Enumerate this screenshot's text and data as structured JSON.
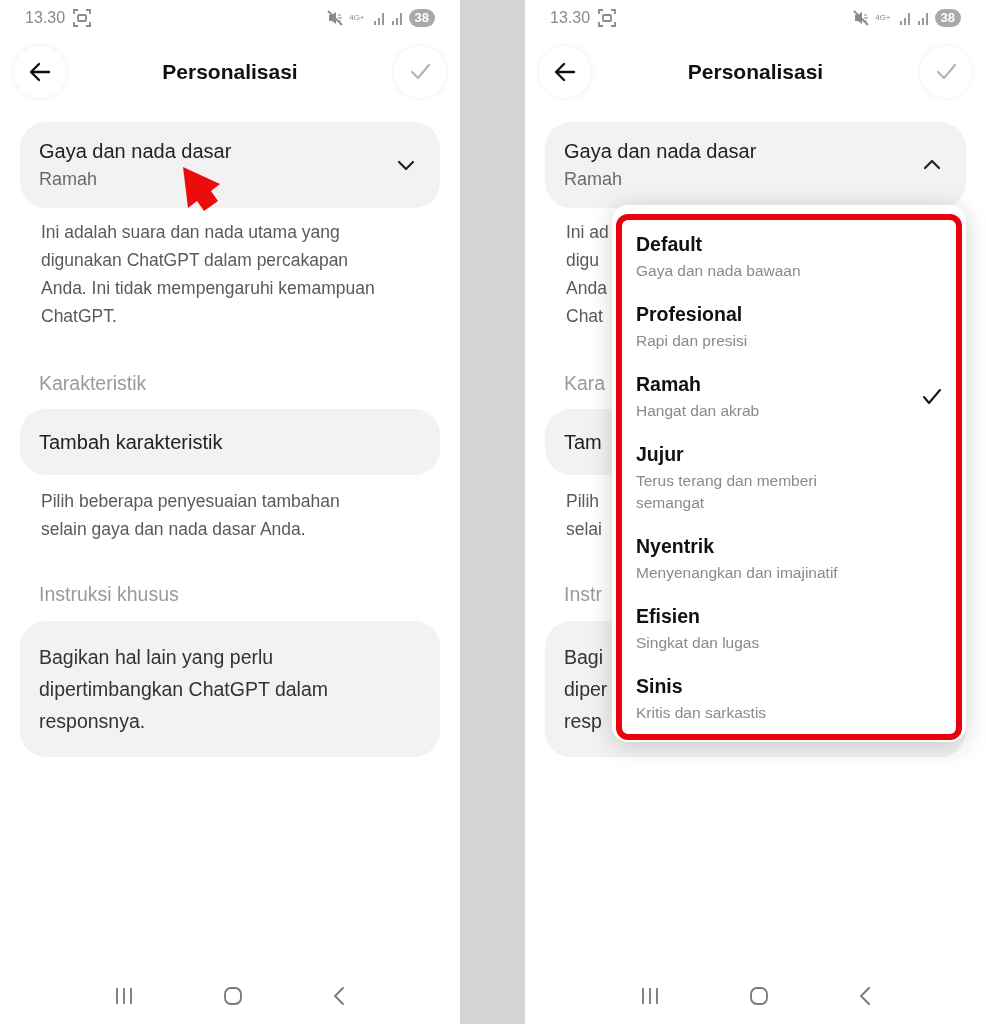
{
  "screens": [
    {
      "status_bar": {
        "time": "13.30",
        "network": "4G+",
        "battery": "38"
      },
      "header": {
        "title": "Personalisasi"
      },
      "style_field": {
        "label": "Gaya dan nada dasar",
        "value": "Ramah",
        "expanded": false
      },
      "style_description": {
        "text": "Ini adalah suara dan nada utama yang digunakan ChatGPT dalam percakapan Anda. Ini tidak mempengaruhi kemampuan ChatGPT."
      },
      "characteristics": {
        "heading": "Karakteristik",
        "button": "Tambah karakteristik",
        "hint": "Pilih beberapa penyesuaian tambahan selain gaya dan nada dasar Anda."
      },
      "custom_instructions": {
        "heading": "Instruksi khusus",
        "placeholder": "Bagikan hal lain yang perlu dipertimbangkan ChatGPT dalam responsnya."
      },
      "annotation": {
        "kind": "arrow"
      }
    },
    {
      "status_bar": {
        "time": "13.30",
        "network": "4G+",
        "battery": "38"
      },
      "header": {
        "title": "Personalisasi"
      },
      "style_field": {
        "label": "Gaya dan nada dasar",
        "value": "Ramah",
        "expanded": true
      },
      "style_description": {
        "lines": [
          "Ini ad",
          "digu",
          "Anda",
          "Chat"
        ]
      },
      "characteristics": {
        "heading": "Kara",
        "button": "Tam",
        "hint_lines": [
          "Pilih",
          "selai"
        ]
      },
      "custom_instructions": {
        "heading": "Instr",
        "placeholder_lines": [
          "Bagi",
          "diper",
          "resp"
        ]
      },
      "annotation": {
        "kind": "frame"
      },
      "dropdown": {
        "options": [
          {
            "title": "Default",
            "subtitle": "Gaya dan nada bawaan",
            "selected": false
          },
          {
            "title": "Profesional",
            "subtitle": "Rapi dan presisi",
            "selected": false
          },
          {
            "title": "Ramah",
            "subtitle": "Hangat dan akrab",
            "selected": true
          },
          {
            "title": "Jujur",
            "subtitle": "Terus terang dan memberi semangat",
            "selected": false
          },
          {
            "title": "Nyentrik",
            "subtitle": "Menyenangkan dan imajinatif",
            "selected": false
          },
          {
            "title": "Efisien",
            "subtitle": "Singkat dan lugas",
            "selected": false
          },
          {
            "title": "Sinis",
            "subtitle": "Kritis dan sarkastis",
            "selected": false
          }
        ]
      }
    }
  ]
}
